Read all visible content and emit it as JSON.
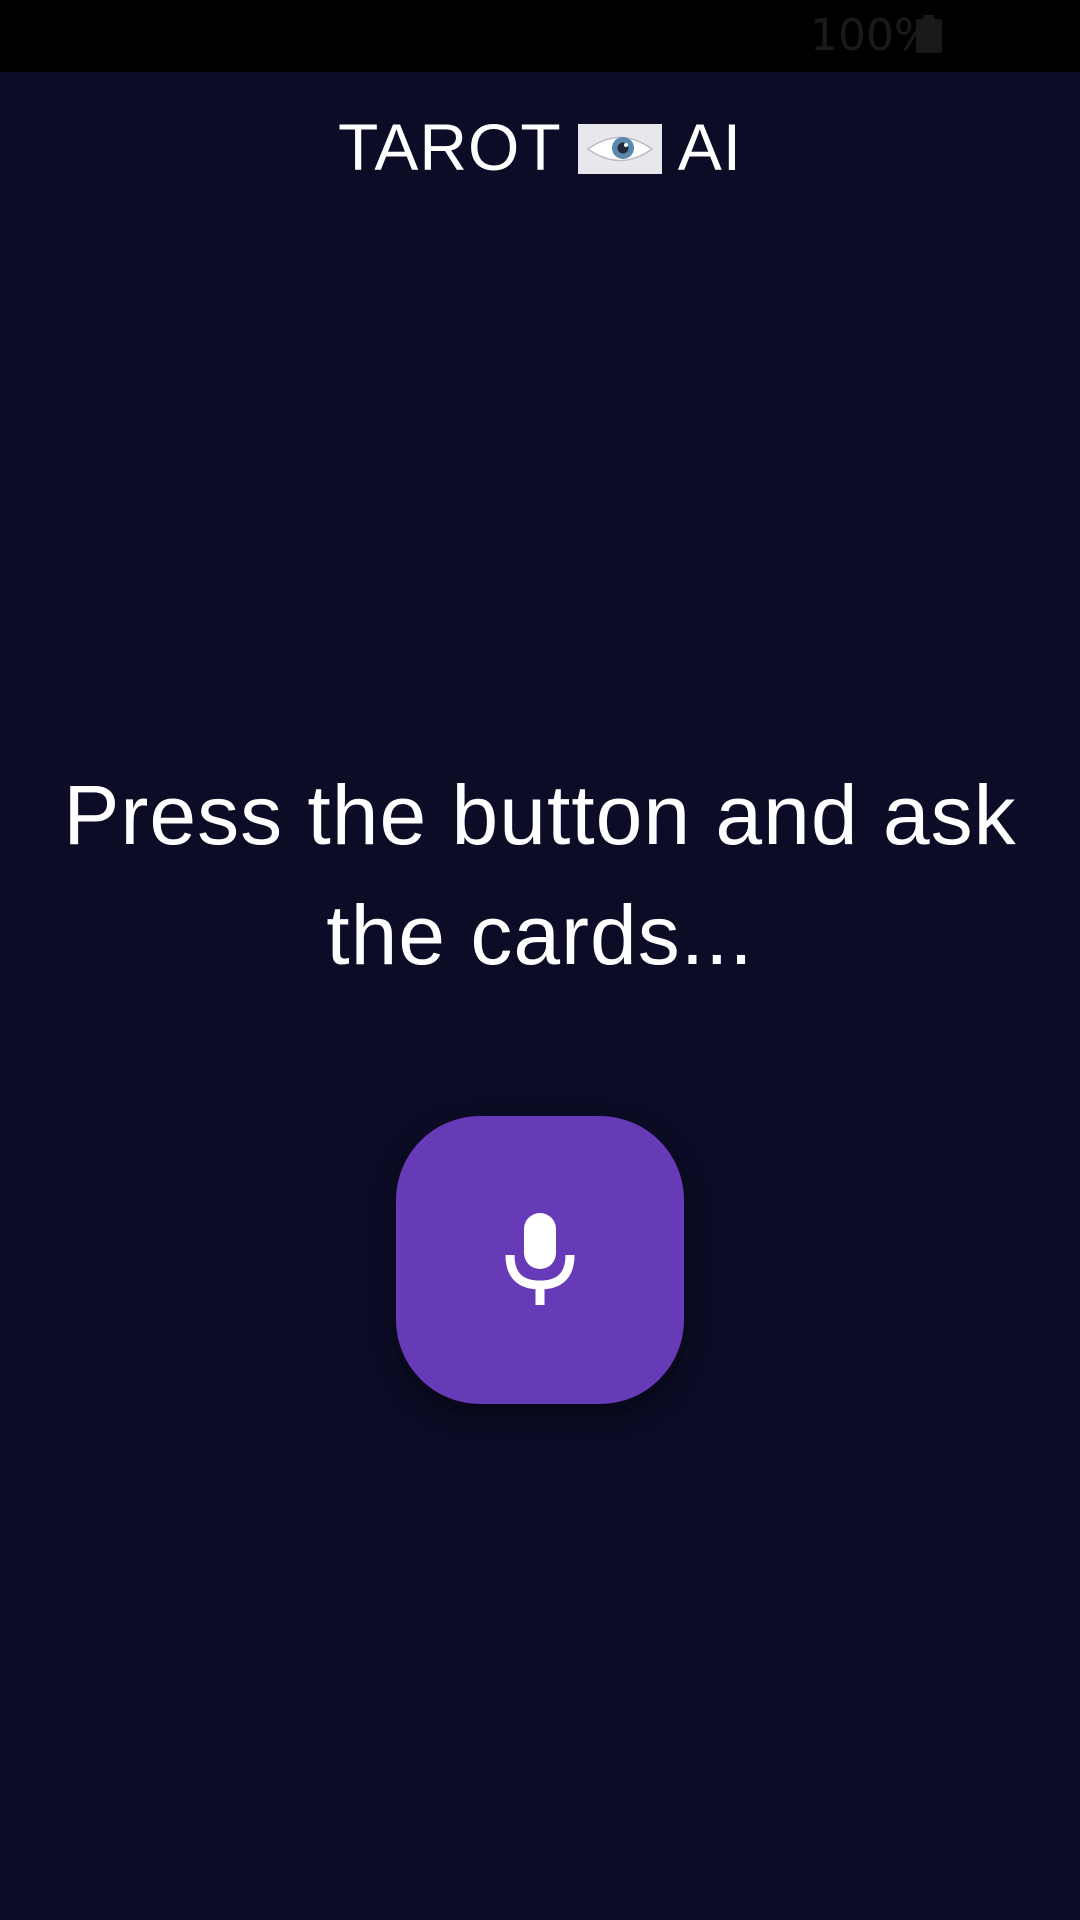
{
  "status_bar": {
    "battery_text": "100%",
    "battery_icon": "battery-full-icon"
  },
  "app_bar": {
    "title_left": "TAROT",
    "title_icon": "eye-icon",
    "title_right": "AI"
  },
  "main": {
    "prompt": "Press the button and ask the cards...",
    "mic_button_icon": "microphone-icon"
  },
  "colors": {
    "background": "#0c0c26",
    "status_bar": "#000000",
    "accent": "#673ab7",
    "text": "#ffffff"
  }
}
